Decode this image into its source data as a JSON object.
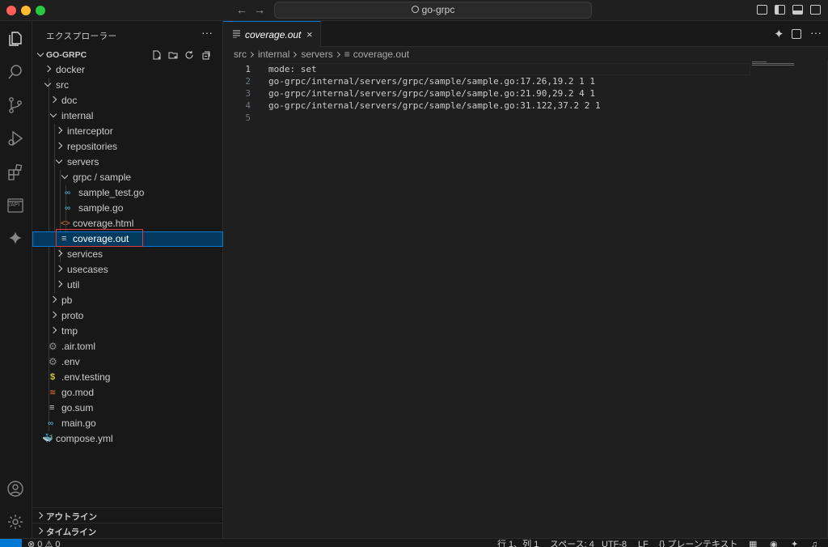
{
  "titlebar": {
    "search_text": "go-grpc"
  },
  "activity": {
    "icons": [
      "explorer-icon",
      "search-icon",
      "source-control-icon",
      "run-debug-icon",
      "extensions-icon",
      "api-icon",
      "sparkle-icon",
      "account-icon",
      "settings-gear-icon"
    ],
    "api_label": "/API"
  },
  "sidebar": {
    "header": "エクスプローラー",
    "more": "···",
    "section_title": "GO-GRPC",
    "tree": [
      {
        "label": "docker"
      },
      {
        "label": "src"
      },
      {
        "label": "doc"
      },
      {
        "label": "internal"
      },
      {
        "label": "interceptor"
      },
      {
        "label": "repositories"
      },
      {
        "label": "servers"
      },
      {
        "label": "grpc / sample"
      },
      {
        "label": "sample_test.go",
        "icon": "∞"
      },
      {
        "label": "sample.go",
        "icon": "∞"
      },
      {
        "label": "coverage.html",
        "icon": "<>"
      },
      {
        "label": "coverage.out"
      },
      {
        "label": "services"
      },
      {
        "label": "usecases"
      },
      {
        "label": "util"
      },
      {
        "label": "pb"
      },
      {
        "label": "proto"
      },
      {
        "label": "tmp"
      },
      {
        "label": ".air.toml"
      },
      {
        "label": ".env"
      },
      {
        "label": ".env.testing",
        "icon": "$"
      },
      {
        "label": "go.mod"
      },
      {
        "label": "go.sum"
      },
      {
        "label": "main.go",
        "icon": "∞"
      },
      {
        "label": "compose.yml"
      }
    ],
    "outline": "アウトライン",
    "timeline": "タイムライン"
  },
  "editor": {
    "tab_label": "coverage.out",
    "tab_close": "×",
    "breadcrumb": [
      "src",
      "internal",
      "servers",
      "coverage.out"
    ],
    "lines": [
      {
        "num": "1",
        "text": "mode: set"
      },
      {
        "num": "2",
        "text": "go-grpc/internal/servers/grpc/sample/sample.go:17.26,19.2 1 1"
      },
      {
        "num": "3",
        "text": "go-grpc/internal/servers/grpc/sample/sample.go:21.90,29.2 4 1"
      },
      {
        "num": "4",
        "text": "go-grpc/internal/servers/grpc/sample/sample.go:31.122,37.2 2 1"
      },
      {
        "num": "5",
        "text": ""
      }
    ]
  },
  "statusbar": {
    "problems": "⊗ 0 ⚠ 0",
    "position": "行 1、列 1",
    "spaces": "スペース: 4",
    "encoding": "UTF-8",
    "eol": "LF",
    "language": "{} プレーンテキスト"
  },
  "colors": {
    "accent": "#0078d4",
    "highlight_box": "#e03c3c",
    "go_icon": "#519aba",
    "html_icon": "#e37933",
    "env_icon": "#cbcb41",
    "docker_icon": "#f55385"
  }
}
